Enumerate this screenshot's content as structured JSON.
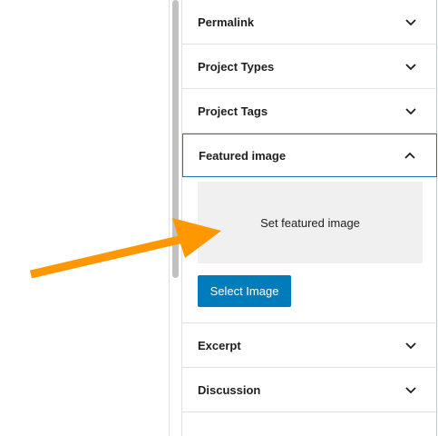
{
  "sidebar": {
    "panels": {
      "permalink": {
        "title": "Permalink"
      },
      "project_types": {
        "title": "Project Types"
      },
      "project_tags": {
        "title": "Project Tags"
      },
      "featured_image": {
        "title": "Featured image",
        "placeholder_label": "Set featured image",
        "select_button_label": "Select Image"
      },
      "excerpt": {
        "title": "Excerpt"
      },
      "discussion": {
        "title": "Discussion"
      }
    }
  },
  "colors": {
    "accent": "#007cba",
    "focus_border": "#2271b1",
    "arrow": "#ff9800"
  }
}
